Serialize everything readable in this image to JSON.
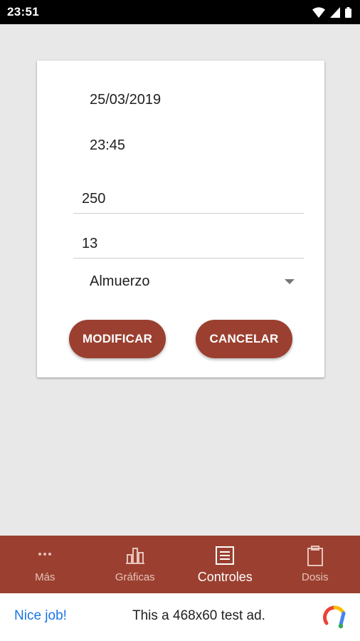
{
  "status_bar": {
    "time": "23:51",
    "icons": [
      "wifi-icon",
      "signal-icon",
      "battery-icon"
    ]
  },
  "form": {
    "date": "25/03/2019",
    "time": "23:45",
    "quantity": "250",
    "units": "13",
    "meal": "Almuerzo",
    "modify_label": "MODIFICAR",
    "cancel_label": "CANCELAR"
  },
  "bottom_nav": {
    "items": [
      {
        "label": "Más",
        "icon": "more-dots-icon",
        "active": false
      },
      {
        "label": "Gráficas",
        "icon": "bar-chart-icon",
        "active": false
      },
      {
        "label": "Controles",
        "icon": "list-icon",
        "active": true
      },
      {
        "label": "Dosis",
        "icon": "clipboard-icon",
        "active": false
      }
    ]
  },
  "ad": {
    "left_text": "Nice job!",
    "text": "This a 468x60 test ad.",
    "logo_icon": "ad-logo-icon"
  },
  "colors": {
    "primary": "#9b4030",
    "background": "#e8e8e8",
    "ad_link": "#1a73e8"
  }
}
